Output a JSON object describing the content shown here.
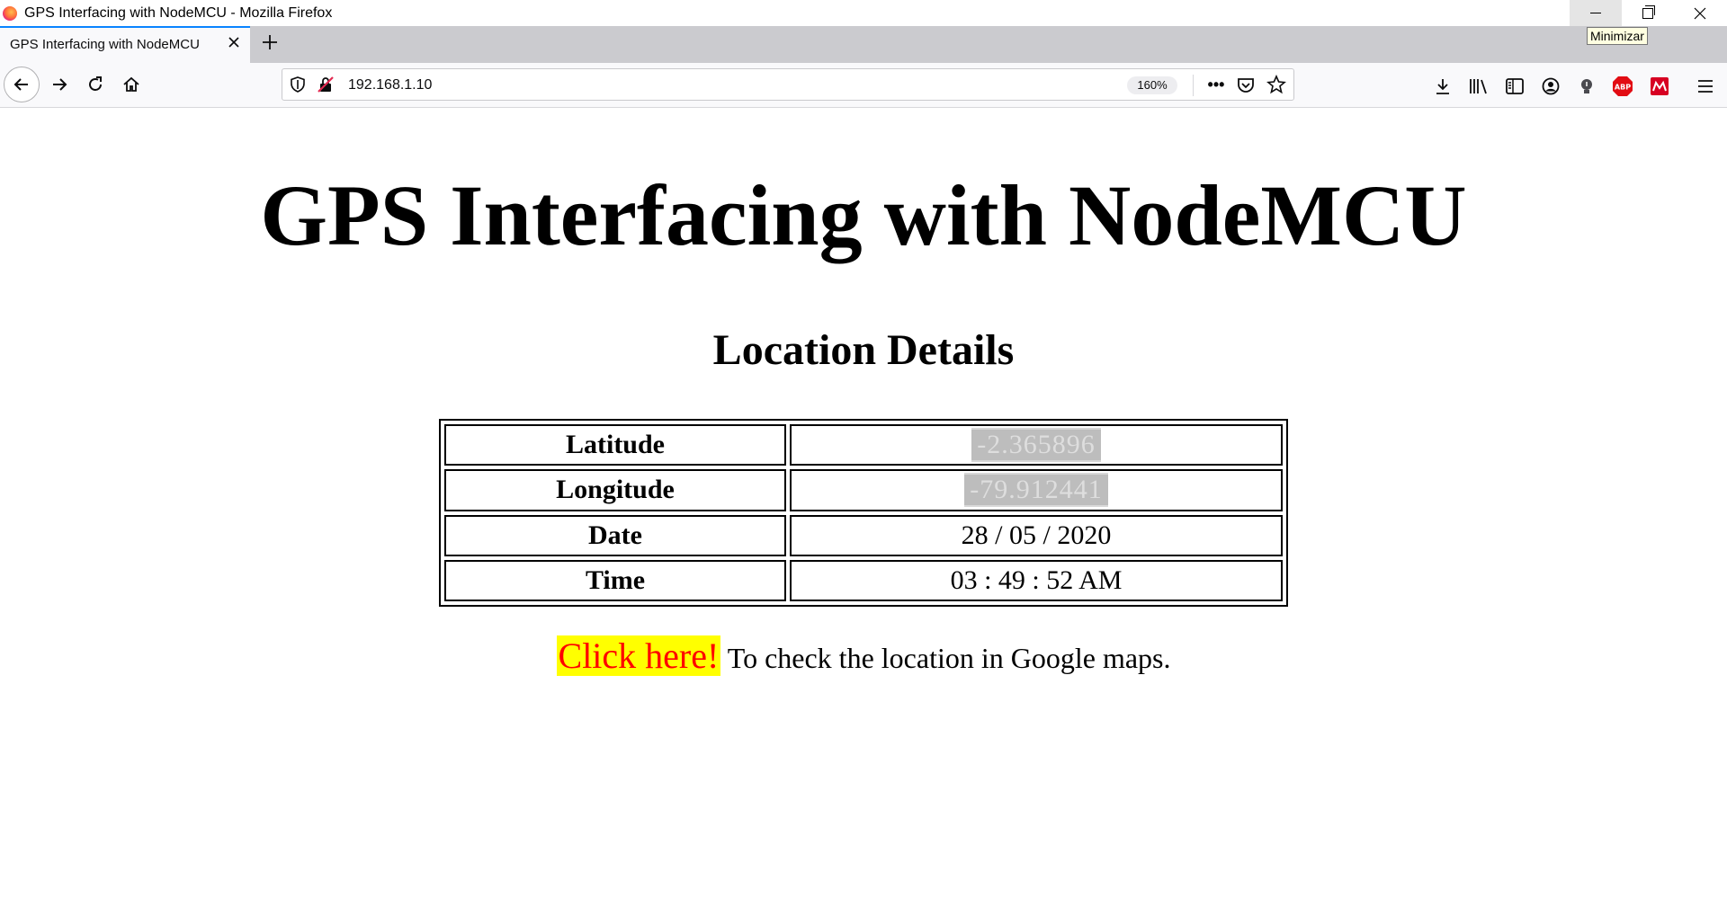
{
  "window": {
    "title": "GPS Interfacing with NodeMCU - Mozilla Firefox",
    "tooltip": "Minimizar"
  },
  "tabs": [
    {
      "label": "GPS Interfacing with NodeMCU",
      "active": true
    }
  ],
  "navbar": {
    "url": "192.168.1.10",
    "zoom": "160%",
    "overflow_label": "•••"
  },
  "page": {
    "heading": "GPS Interfacing with NodeMCU",
    "subheading": "Location Details",
    "table": [
      {
        "label": "Latitude",
        "value": "-2.365896",
        "redacted": true
      },
      {
        "label": "Longitude",
        "value": "-79.912441",
        "redacted": true
      },
      {
        "label": "Date",
        "value": "28 / 05 / 2020",
        "redacted": false
      },
      {
        "label": "Time",
        "value": "03 : 49 : 52 AM",
        "redacted": false
      }
    ],
    "link_text": "Click here!",
    "link_suffix": " To check the location in Google maps."
  },
  "colors": {
    "link_background": "#ffff00",
    "link_text": "#ff0000",
    "tab_accent": "#0a84ff",
    "abp_red": "#e20c13"
  },
  "icons": {
    "abp_badge": "ABP"
  }
}
